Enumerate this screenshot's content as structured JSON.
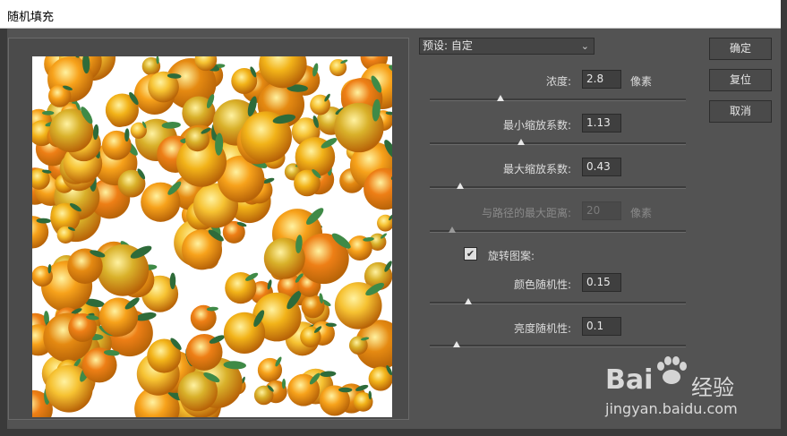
{
  "window": {
    "title": "随机填充"
  },
  "preset": {
    "label": "预设: 自定"
  },
  "params": [
    {
      "label": "浓度:",
      "value": "2.8",
      "unit": "像素",
      "slider": 0.28,
      "disabled": false
    },
    {
      "label": "最小缩放系数:",
      "value": "1.13",
      "unit": "",
      "slider": 0.36,
      "disabled": false
    },
    {
      "label": "最大缩放系数:",
      "value": "0.43",
      "unit": "",
      "slider": 0.12,
      "disabled": false
    },
    {
      "label": "与路径的最大距离:",
      "value": "20",
      "unit": "像素",
      "slider": 0.08,
      "disabled": true
    }
  ],
  "rotate": {
    "label": "旋转图案:",
    "checked": true
  },
  "params2": [
    {
      "label": "颜色随机性:",
      "value": "0.15",
      "slider": 0.15
    },
    {
      "label": "亮度随机性:",
      "value": "0.1",
      "slider": 0.1
    }
  ],
  "buttons": {
    "ok": "确定",
    "reset": "复位",
    "cancel": "取消"
  },
  "watermark": {
    "brand": "Bai",
    "brand2": "经验",
    "url": "jingyan.baidu.com"
  },
  "colors": {
    "dialog_bg": "#535353",
    "orange": "#f5a623",
    "leaf": "#2e6b3a"
  }
}
